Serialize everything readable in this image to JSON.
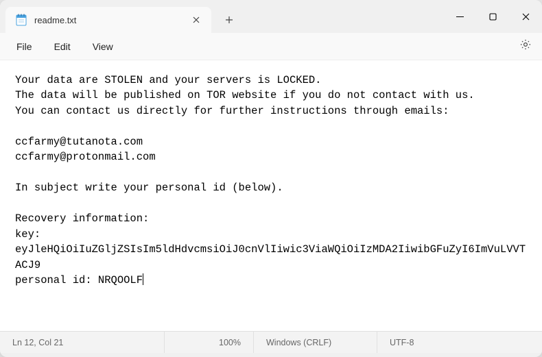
{
  "tab": {
    "title": "readme.txt"
  },
  "menu": {
    "file": "File",
    "edit": "Edit",
    "view": "View"
  },
  "document": {
    "body": "Your data are STOLEN and your servers is LOCKED.\nThe data will be published on TOR website if you do not contact with us.\nYou can contact us directly for further instructions through emails:\n\nccfarmy@tutanota.com\nccfarmy@protonmail.com\n\nIn subject write your personal id (below).\n\nRecovery information:\nkey: eyJleHQiOiIuZGljZSIsIm5ldHdvcmsiOiJ0cnVlIiwic3ViaWQiOiIzMDA2IiwibGFuZyI6ImVuLVVTACJ9\npersonal id: NRQOOLF"
  },
  "status": {
    "cursor": "Ln 12, Col 21",
    "zoom": "100%",
    "lineEnding": "Windows (CRLF)",
    "encoding": "UTF-8"
  }
}
